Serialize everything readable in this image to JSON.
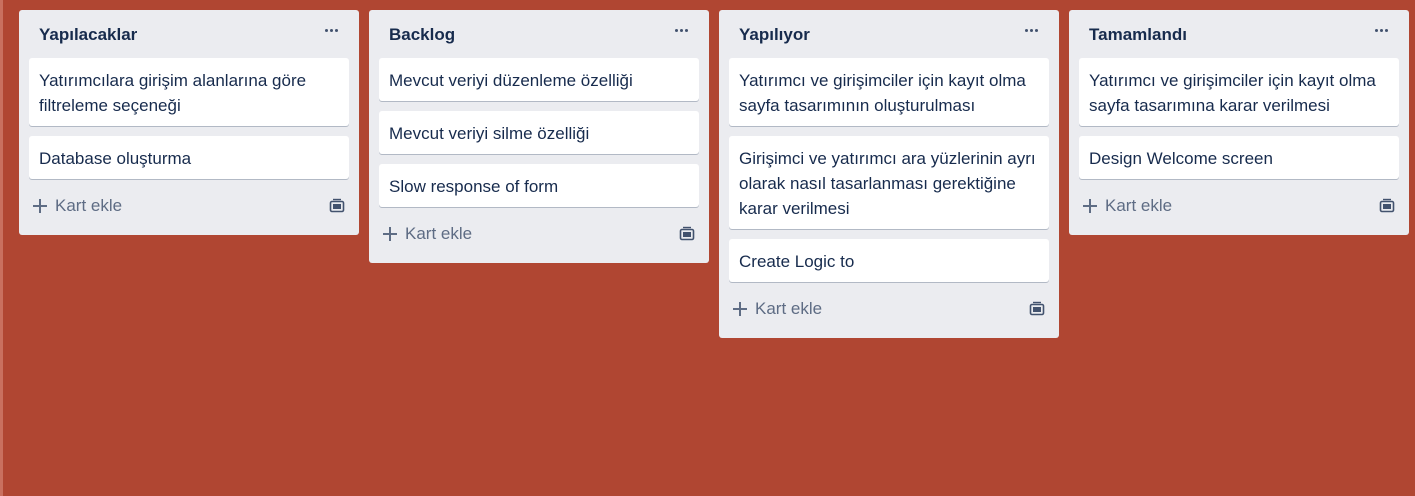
{
  "board": {
    "background_color": "#b04632",
    "lists": [
      {
        "title": "Yapılacaklar",
        "cards": [
          "Yatırımcılara girişim alanlarına göre filtreleme seçeneği",
          "Database oluşturma"
        ],
        "add_card_label": "Kart ekle"
      },
      {
        "title": "Backlog",
        "cards": [
          "Mevcut veriyi düzenleme özelliği",
          "Mevcut veriyi silme özelliği",
          "Slow response of form"
        ],
        "add_card_label": "Kart ekle"
      },
      {
        "title": "Yapılıyor",
        "cards": [
          "Yatırımcı ve girişimciler için kayıt olma sayfa tasarımının oluşturulması",
          "Girişimci ve yatırımcı ara yüzlerinin ayrı olarak nasıl tasarlanması gerektiğine karar verilmesi",
          "Create Logic to"
        ],
        "add_card_label": "Kart ekle"
      },
      {
        "title": "Tamamlandı",
        "cards": [
          "Yatırımcı ve girişimciler için kayıt olma sayfa tasarımına karar verilmesi",
          "Design Welcome screen"
        ],
        "add_card_label": "Kart ekle"
      }
    ]
  },
  "icons": {
    "list_menu": "more-horizontal-icon",
    "add_card": "plus-icon",
    "create_from_template": "template-icon"
  },
  "colors": {
    "list_background": "#ebecf0",
    "card_background": "#ffffff",
    "text": "#172b4d",
    "muted_text": "#5e6c84"
  }
}
